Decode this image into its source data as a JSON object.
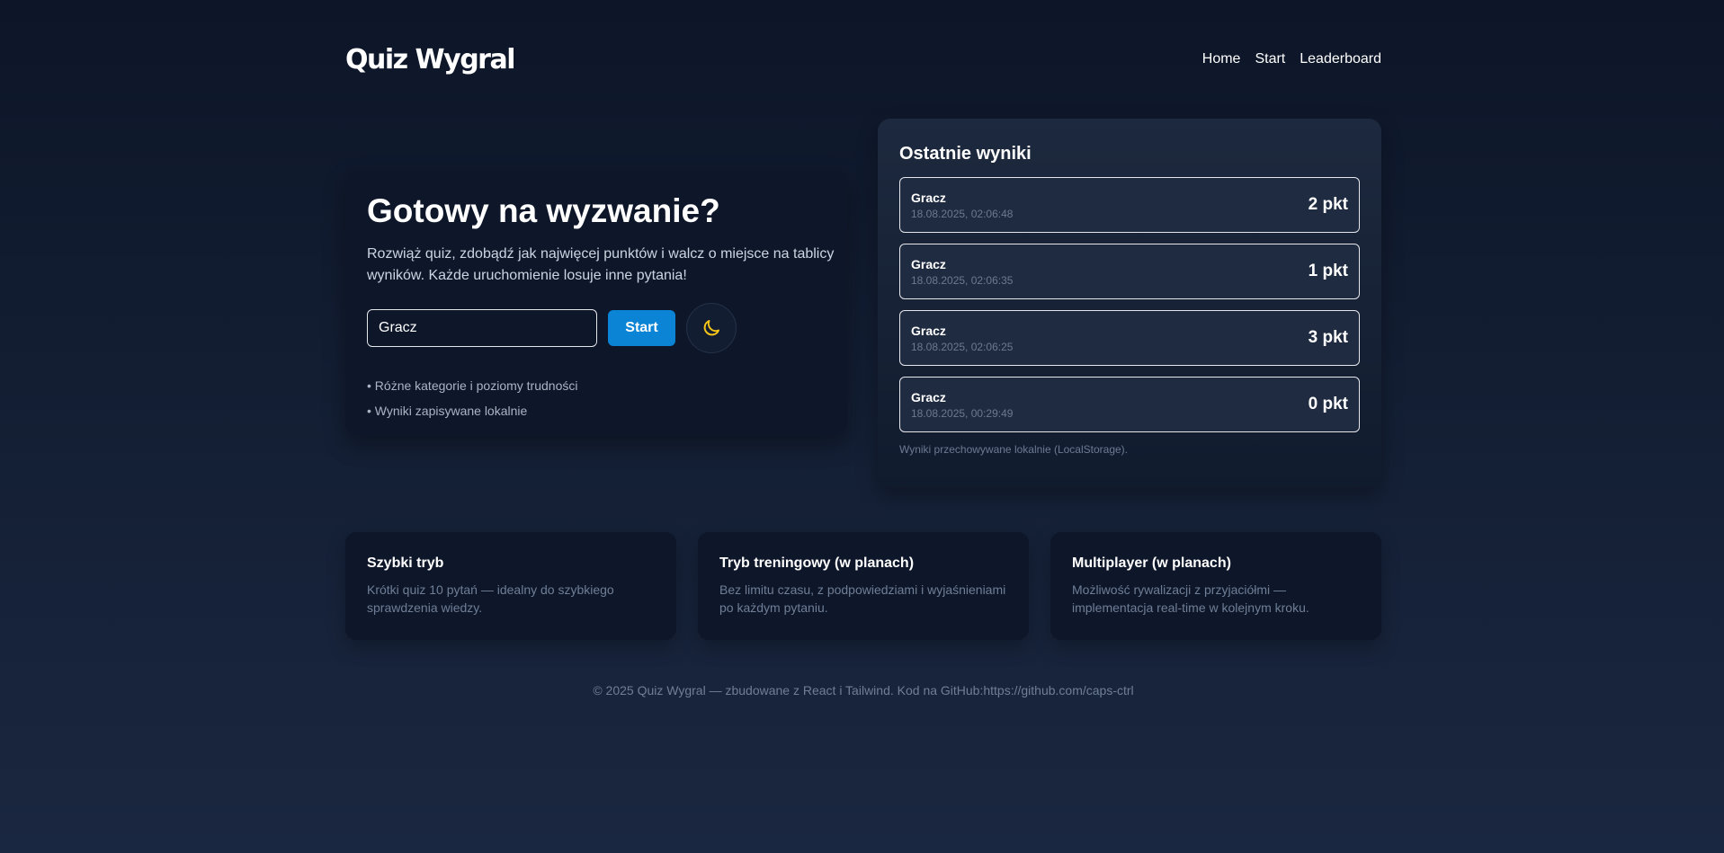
{
  "header": {
    "logo": "Quiz Wygral",
    "nav": [
      "Home",
      "Start",
      "Leaderboard"
    ]
  },
  "hero": {
    "title": "Gotowy na wyzwanie?",
    "lead": "Rozwiąż quiz, zdobądź jak najwięcej punktów i walcz o miejsce na tablicy wyników. Każde uruchomienie losuje inne pytania!",
    "name_value": "Gracz",
    "start_label": "Start",
    "theme_icon": "moon-icon",
    "features": [
      "• Różne kategorie i poziomy trudności",
      "• Wyniki zapisywane lokalnie"
    ]
  },
  "results": {
    "title": "Ostatnie wyniki",
    "items": [
      {
        "name": "Gracz",
        "date": "18.08.2025, 02:06:48",
        "score": "2 pkt"
      },
      {
        "name": "Gracz",
        "date": "18.08.2025, 02:06:35",
        "score": "1 pkt"
      },
      {
        "name": "Gracz",
        "date": "18.08.2025, 02:06:25",
        "score": "3 pkt"
      },
      {
        "name": "Gracz",
        "date": "18.08.2025, 00:29:49",
        "score": "0 pkt"
      }
    ],
    "note": "Wyniki przechowywane lokalnie (LocalStorage)."
  },
  "cards": [
    {
      "title": "Szybki tryb",
      "text": "Krótki quiz 10 pytań — idealny do szybkiego sprawdzenia wiedzy."
    },
    {
      "title": "Tryb treningowy (w planach)",
      "text": "Bez limitu czasu, z podpowiedziami i wyjaśnieniami po każdym pytaniu."
    },
    {
      "title": "Multiplayer (w planach)",
      "text": "Możliwość rywalizacji z przyjaciółmi — implementacja real-time w kolejnym kroku."
    }
  ],
  "footer": "© 2025 Quiz Wygral — zbudowane z React i Tailwind. Kod na GitHub:https://github.com/caps-ctrl",
  "colors": {
    "accent": "#0b84d6",
    "moon": "#f5c518",
    "background": "#0d1628"
  }
}
